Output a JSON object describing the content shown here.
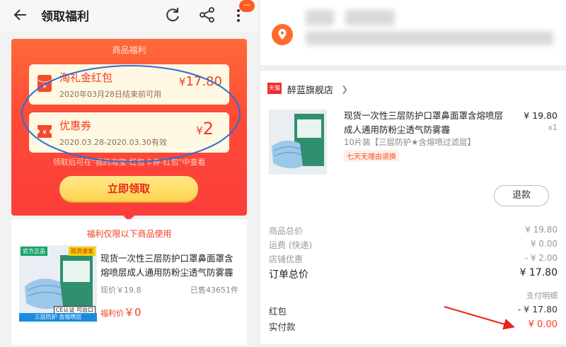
{
  "left": {
    "topbar": {
      "title": "领取福利",
      "badge": "—",
      "icons": [
        "back-arrow-icon",
        "refresh-icon",
        "share-icon",
        "more-icon"
      ]
    },
    "banner": {
      "title": "商品福利",
      "coupons": [
        {
          "name": "淘礼金红包",
          "sub": "2020年03月28日结束前可用",
          "yen": "¥",
          "amount": "17.80"
        },
        {
          "name": "优惠券",
          "sub": "2020.03.28-2020.03.30有效",
          "yen": "¥",
          "amount": "2"
        }
      ],
      "hint": "领取后可在\"我的淘宝-红包卡券-红包\"中查看",
      "claim_button": "立即领取"
    },
    "product": {
      "header": "福利仅限以下商品使用",
      "title": "现货一次性三层防护口罩鼻面罩含熔喷层成人通用防粉尘透气防雾霾",
      "price": "现价￥19.8",
      "sold": "已售43651件",
      "welfare_label": "福利价",
      "welfare_value": "￥0",
      "badges": {
        "official": "官方正品",
        "stock": "现货速发",
        "ce": "CE认证 可出口",
        "bottom": "三层防护 含熔喷层"
      }
    },
    "accent": "#fb3d3b"
  },
  "right": {
    "shop": {
      "tag": "天猫",
      "name": "醉蓝旗舰店"
    },
    "item": {
      "title": "现货一次性三层防护口罩鼻面罩含熔喷层成人通用防粉尘透气防雾霾",
      "price": "¥ 19.80",
      "qty": "x1",
      "spec": "10片装【三层防护★含熔喷过滤层】",
      "tag": "七天无理由退换"
    },
    "refund_button": "退款",
    "summary": [
      {
        "label": "商品总价",
        "value": "¥ 19.80"
      },
      {
        "label": "运费 (快递)",
        "value": "¥ 0.00"
      },
      {
        "label": "店铺优惠",
        "value": "- ¥ 2.00"
      },
      {
        "label": "订单总价",
        "value": "¥ 17.80"
      }
    ],
    "pay_detail": "支付明细",
    "redpacket": {
      "label": "红包",
      "value": "- ¥ 17.80"
    },
    "paid": {
      "label": "实付款",
      "value": "¥ 0.00"
    },
    "accent": "#ff3a1a"
  }
}
